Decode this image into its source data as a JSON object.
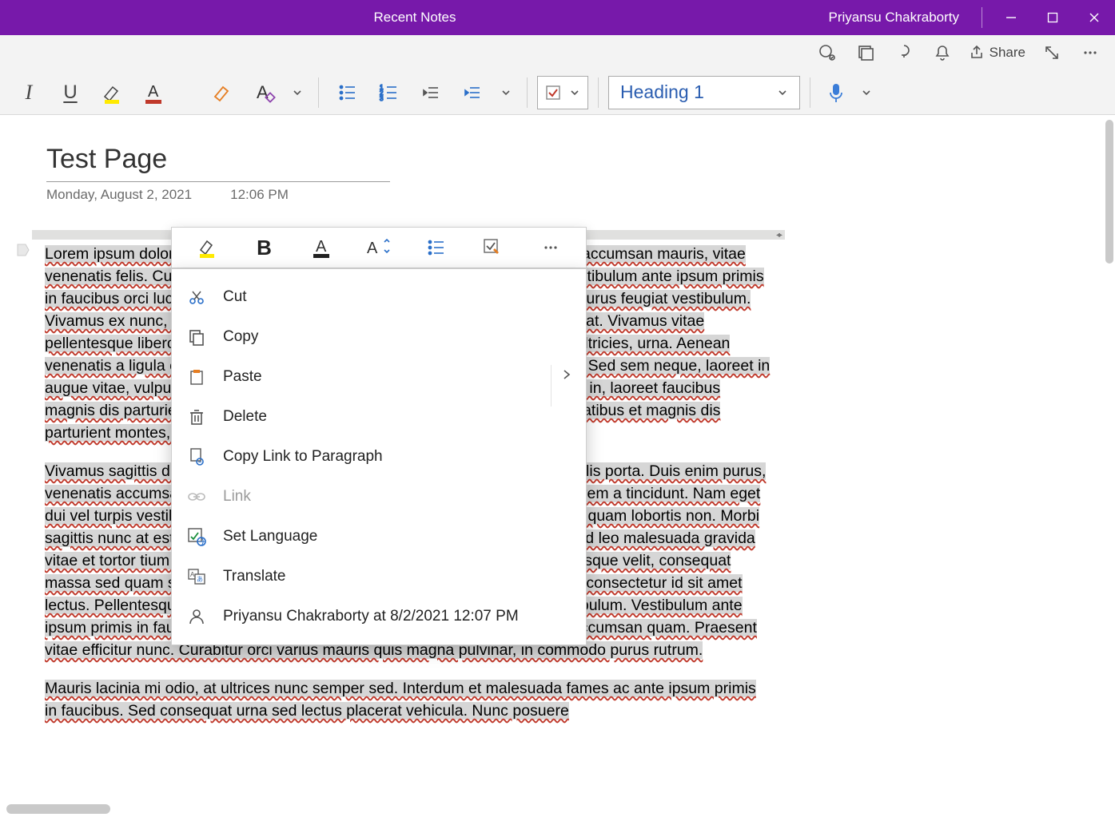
{
  "titlebar": {
    "title": "Recent Notes",
    "user": "Priyansu Chakraborty"
  },
  "cmdstrip": {
    "share_label": "Share"
  },
  "ribbon": {
    "style_name": "Heading 1"
  },
  "page": {
    "title": "Test Page",
    "date": "Monday, August 2, 2021",
    "time": "12:06 PM"
  },
  "body": {
    "p1": "Lorem ipsum dolor sit amet, consectetur adipiscing elit. Pellentesque sit amet accumsan mauris, vitae venenatis felis. Curabitur orci metus, dapibus ut egui vel, gravida sed felis. Vestibulum ante ipsum primis in faucibus orci luctus et ultrices posuere cubilia curae; Quisque auctor ex ac purus feugiat vestibulum. Vivamus ex nunc, imperdiet sed ante elementum porta aliquet magna in volutpat. Vivamus vitae pellentesque libero, convallis imperdiet mi. Praesent suscipit, nulla nec porta ultricies, urna. Aenean venenatis a ligula eu lacinia. Nam eu orci pharetra, congue nisi id, varius arcu. Sed sem neque, laoreet in augue vitae, vulputate faucibus mauris. Praesent efficitur lectus sit amet lectus in, laoreet faucibus magnis dis parturient montes, nascetur ridiculus mus. Orci varius natoque penatibus et magnis dis parturient montes, nascetur ridiculus mus.",
    "p2": "Vivamus sagittis dui, sagittis ultricies mi interdum, interdum nibh et nibh convallis porta. Duis enim purus, venenatis accumsan sit amet, rhoncus nec tortor. Suspendisse eleifend nec lorem a tincidunt. Nam eget dui vel turpis vestibulum maximus. Cras tellus facilisis ipsum, sit amet placerat quam lobortis non. Morbi sagittis nunc at est lacinia interdum, ut pretium velit pulvinar. Nam at massa sed leo malesuada gravida vitae et tortor tium diam, a porta dui felis id ex. Sed quis tortor laoreet, pellentesque velit, consequat massa sed quam sollicitudin finibus. Aenean in interdum velit, mollis est. Nulla consectetur id sit amet lectus. Pellentesque lobortis, imperdiet a posuere velit. In hac habitasse, vestibulum. Vestibulum ante ipsum primis in faucibus orci luctus et ultrices posuere cubilia curae; Cras id accumsan quam. Praesent vitae efficitur nunc. Curabitur orci varius mauris quis magna pulvinar, in commodo purus rutrum.",
    "p3": "Mauris lacinia mi odio, at ultrices nunc semper sed. Interdum et malesuada fames ac ante ipsum primis in faucibus. Sed consequat urna sed lectus placerat vehicula. Nunc posuere"
  },
  "context_menu": {
    "cut": "Cut",
    "copy": "Copy",
    "paste": "Paste",
    "delete": "Delete",
    "copylink": "Copy Link to Paragraph",
    "link": "Link",
    "setlang": "Set Language",
    "translate": "Translate",
    "author": "Priyansu Chakraborty at 8/2/2021 12:07 PM"
  }
}
